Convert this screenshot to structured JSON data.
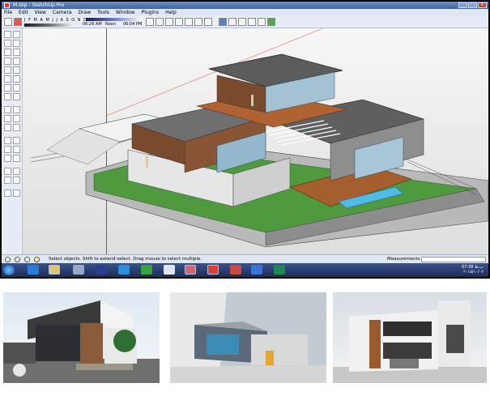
{
  "window": {
    "title": "M.skp - SketchUp Pro",
    "controls": [
      "_",
      "□",
      "x"
    ]
  },
  "menu": [
    "File",
    "Edit",
    "View",
    "Camera",
    "Draw",
    "Tools",
    "Window",
    "Plugins",
    "Help"
  ],
  "toolbar": {
    "months": "J F M A M J J A S O N D",
    "time_start": "06:26 AM",
    "noon_label": "Noon",
    "time_end": "06:04 PM"
  },
  "status": {
    "message": "Select objects. Shift to extend select. Drag mouse to select multiple.",
    "measurements_label": "Measurements"
  },
  "taskbar": {
    "clock_time": "07:38 ب.ظ",
    "clock_date": "۲۰۱۵/۱۰/۰۲"
  },
  "colors": {
    "title_bar": "#3f62a3",
    "viewport": "#e9e9e9",
    "taskbar": "#1d2c55",
    "wood": "#7a4a2c",
    "roof": "#5f5f5f",
    "lawn": "#4f9a3f",
    "pool": "#53b9e6"
  },
  "icons": {
    "select": "arrow-icon",
    "paint": "paint-bucket-icon",
    "orbit": "orbit-icon",
    "pan": "hand-icon",
    "zoom": "magnifier-icon",
    "start": "windows-orb-icon",
    "ie": "internet-explorer-icon",
    "explorer": "folder-icon",
    "photoshop": "photoshop-icon",
    "sketchup": "sketchup-icon"
  }
}
